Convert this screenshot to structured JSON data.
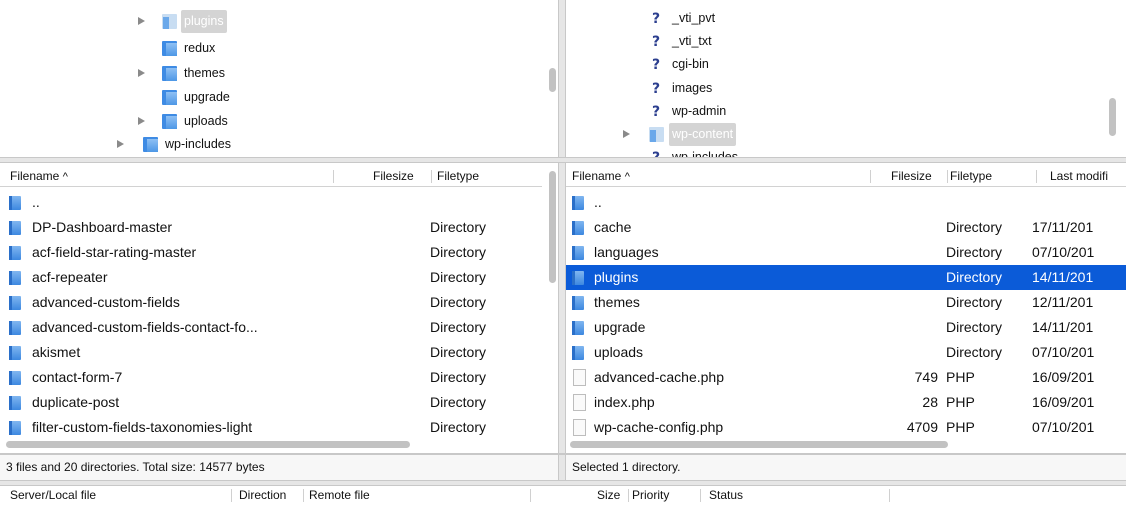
{
  "local_tree": {
    "items": [
      {
        "label": "plugins",
        "expandable": true,
        "selected": true
      },
      {
        "label": "redux",
        "expandable": false
      },
      {
        "label": "themes",
        "expandable": true
      },
      {
        "label": "upgrade",
        "expandable": false
      },
      {
        "label": "uploads",
        "expandable": true
      },
      {
        "label": "wp-includes",
        "expandable": true
      }
    ]
  },
  "remote_tree": {
    "items": [
      {
        "label": "_vti_pvt",
        "icon": "unknown"
      },
      {
        "label": "_vti_txt",
        "icon": "unknown"
      },
      {
        "label": "cgi-bin",
        "icon": "unknown"
      },
      {
        "label": "images",
        "icon": "unknown"
      },
      {
        "label": "wp-admin",
        "icon": "unknown"
      },
      {
        "label": "wp-content",
        "icon": "folder",
        "selected": true
      },
      {
        "label": "wp-includes",
        "icon": "unknown"
      }
    ]
  },
  "local_list": {
    "columns": {
      "filename": "Filename",
      "filesize": "Filesize",
      "filetype": "Filetype"
    },
    "rows": [
      {
        "name": "..",
        "size": "",
        "type": ""
      },
      {
        "name": "DP-Dashboard-master",
        "size": "",
        "type": "Directory"
      },
      {
        "name": "acf-field-star-rating-master",
        "size": "",
        "type": "Directory"
      },
      {
        "name": "acf-repeater",
        "size": "",
        "type": "Directory"
      },
      {
        "name": "advanced-custom-fields",
        "size": "",
        "type": "Directory"
      },
      {
        "name": "advanced-custom-fields-contact-fo...",
        "size": "",
        "type": "Directory"
      },
      {
        "name": "akismet",
        "size": "",
        "type": "Directory"
      },
      {
        "name": "contact-form-7",
        "size": "",
        "type": "Directory"
      },
      {
        "name": "duplicate-post",
        "size": "",
        "type": "Directory"
      },
      {
        "name": "filter-custom-fields-taxonomies-light",
        "size": "",
        "type": "Directory"
      }
    ],
    "status": "3 files and 20 directories. Total size: 14577 bytes"
  },
  "remote_list": {
    "columns": {
      "filename": "Filename",
      "filesize": "Filesize",
      "filetype": "Filetype",
      "modified": "Last modifi"
    },
    "rows": [
      {
        "name": "..",
        "size": "",
        "type": "",
        "modified": "",
        "kind": "folder"
      },
      {
        "name": "cache",
        "size": "",
        "type": "Directory",
        "modified": "17/11/201",
        "kind": "folder"
      },
      {
        "name": "languages",
        "size": "",
        "type": "Directory",
        "modified": "07/10/201",
        "kind": "folder"
      },
      {
        "name": "plugins",
        "size": "",
        "type": "Directory",
        "modified": "14/11/201",
        "kind": "folder",
        "selected": true
      },
      {
        "name": "themes",
        "size": "",
        "type": "Directory",
        "modified": "12/11/201",
        "kind": "folder"
      },
      {
        "name": "upgrade",
        "size": "",
        "type": "Directory",
        "modified": "14/11/201",
        "kind": "folder"
      },
      {
        "name": "uploads",
        "size": "",
        "type": "Directory",
        "modified": "07/10/201",
        "kind": "folder"
      },
      {
        "name": "advanced-cache.php",
        "size": "749",
        "type": "PHP",
        "modified": "16/09/201",
        "kind": "file"
      },
      {
        "name": "index.php",
        "size": "28",
        "type": "PHP",
        "modified": "16/09/201",
        "kind": "file"
      },
      {
        "name": "wp-cache-config.php",
        "size": "4709",
        "type": "PHP",
        "modified": "07/10/201",
        "kind": "file"
      }
    ],
    "status": "Selected 1 directory."
  },
  "queue": {
    "columns": {
      "server_local": "Server/Local file",
      "direction": "Direction",
      "remote": "Remote file",
      "size": "Size",
      "priority": "Priority",
      "status": "Status"
    }
  },
  "colors": {
    "selection": "#0b5bd8",
    "folder": "#3d88e0",
    "unknown_icon": "#2c3f8f"
  }
}
